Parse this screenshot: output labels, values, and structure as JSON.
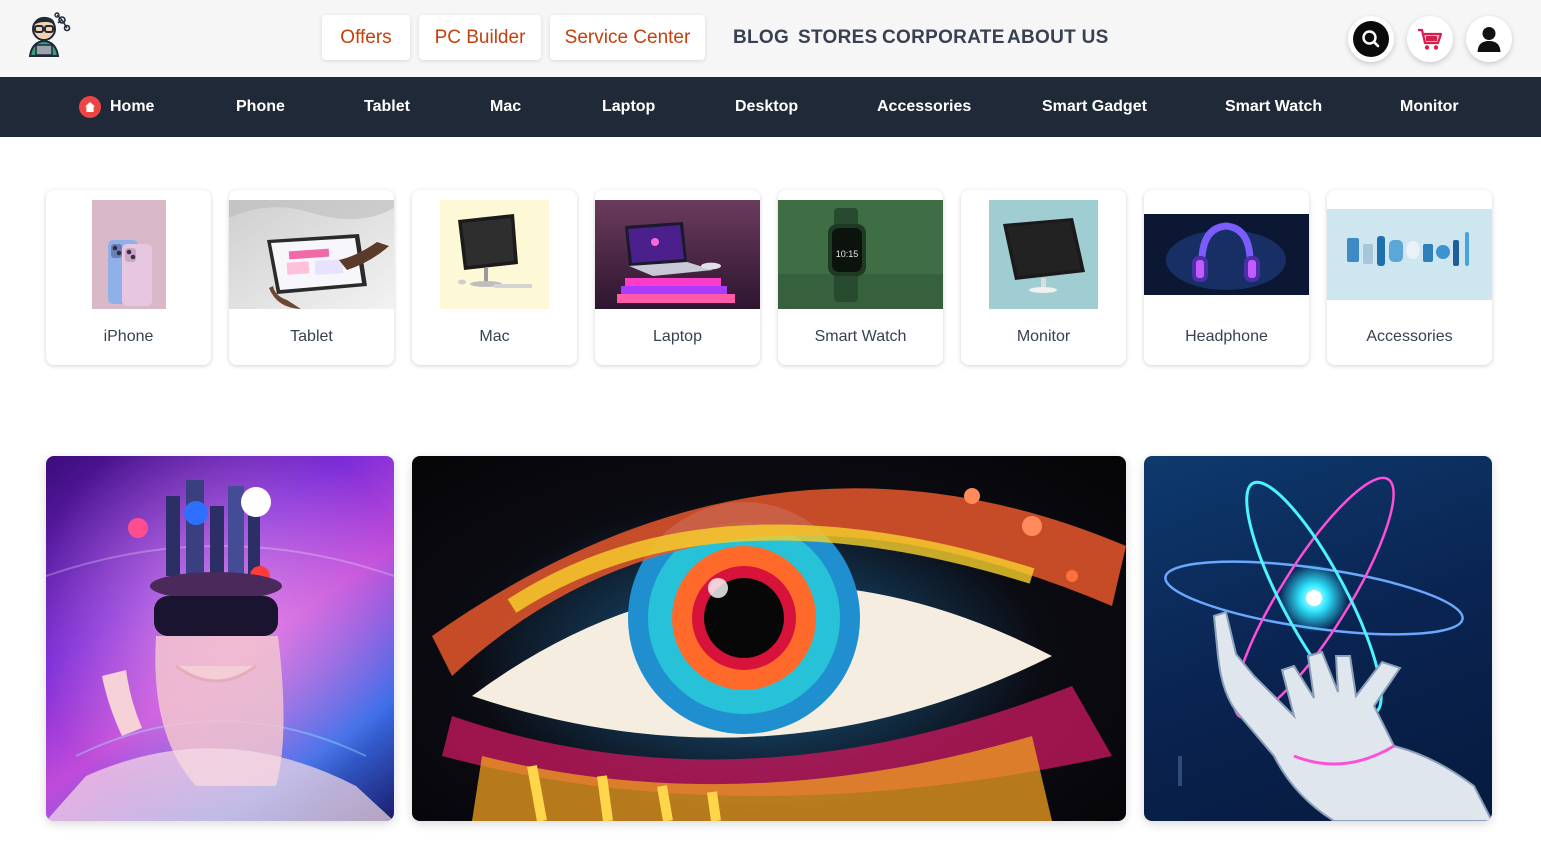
{
  "header": {
    "logo_icon": "nerd-mascot-logo",
    "pills": {
      "offers": "Offers",
      "pc_builder": "PC Builder",
      "service_center": "Service Center"
    },
    "links": {
      "blog": "BLOG",
      "stores": "STORES",
      "corporate": "CORPORATE",
      "about": "ABOUT US"
    },
    "icons": [
      "search-icon",
      "cart-icon",
      "user-icon"
    ],
    "accent_color": "#c2410c"
  },
  "nav": {
    "background": "#1f2937",
    "items": [
      "Home",
      "Phone",
      "Tablet",
      "Mac",
      "Laptop",
      "Desktop",
      "Accessories",
      "Smart Gadget",
      "Smart Watch",
      "Monitor"
    ]
  },
  "categories": {
    "cards": [
      {
        "label": "iPhone",
        "image": "iphone-photo"
      },
      {
        "label": "Tablet",
        "image": "tablet-photo"
      },
      {
        "label": "Mac",
        "image": "imac-photo"
      },
      {
        "label": "Laptop",
        "image": "laptop-photo"
      },
      {
        "label": "Smart Watch",
        "image": "smartwatch-photo"
      },
      {
        "label": "Monitor",
        "image": "monitor-photo"
      },
      {
        "label": "Headphone",
        "image": "headphone-photo"
      },
      {
        "label": "Accessories",
        "image": "accessories-photo"
      }
    ],
    "watch_time": "10:15"
  },
  "banners": [
    {
      "image": "vr-headset-woman-banner"
    },
    {
      "image": "colorful-eye-banner"
    },
    {
      "image": "robot-hand-atom-banner"
    }
  ]
}
